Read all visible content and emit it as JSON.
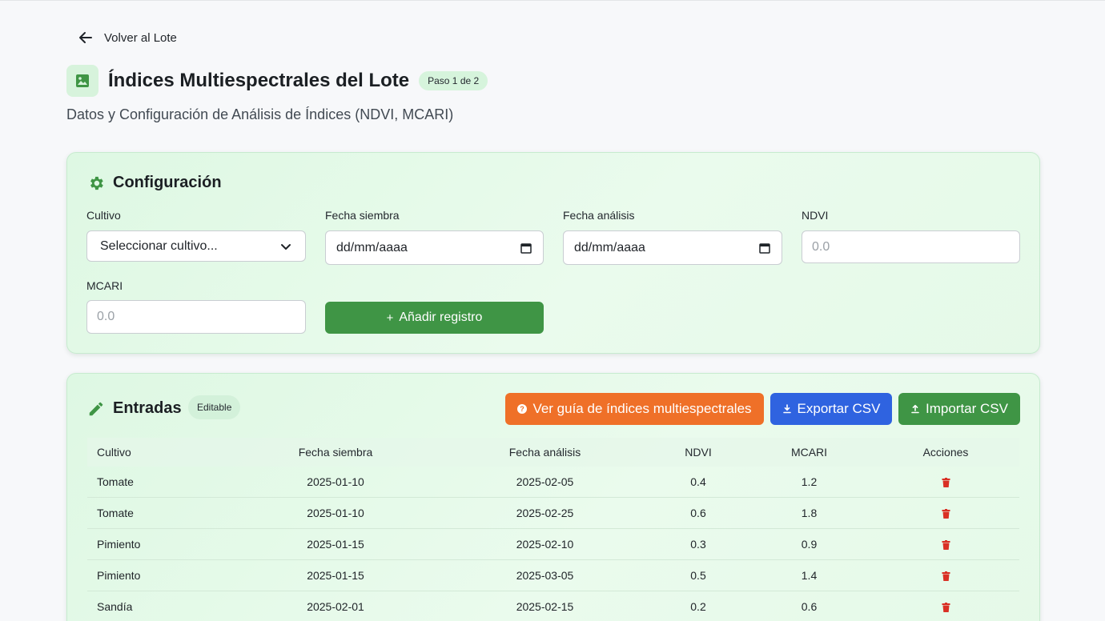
{
  "nav": {
    "back_label": "Volver al Lote"
  },
  "header": {
    "title": "Índices Multiespectrales del Lote",
    "step_badge": "Paso 1 de 2",
    "subtitle": "Datos y Configuración de Análisis de Índices (NDVI, MCARI)"
  },
  "config": {
    "title": "Configuración",
    "fields": {
      "cultivo": {
        "label": "Cultivo",
        "value": "Seleccionar cultivo..."
      },
      "fecha_siembra": {
        "label": "Fecha siembra",
        "value": "dd/mm/aaaa"
      },
      "fecha_analisis": {
        "label": "Fecha análisis",
        "value": "dd/mm/aaaa"
      },
      "ndvi": {
        "label": "NDVI",
        "placeholder": "0.0"
      },
      "mcari": {
        "label": "MCARI",
        "placeholder": "0.0"
      }
    },
    "add_button": "Añadir registro"
  },
  "entries": {
    "title": "Entradas",
    "badge": "Editable",
    "guide_button": "Ver guía de índices multiespectrales",
    "export_button": "Exportar CSV",
    "import_button": "Importar CSV",
    "columns": [
      "Cultivo",
      "Fecha siembra",
      "Fecha análisis",
      "NDVI",
      "MCARI",
      "Acciones"
    ],
    "rows": [
      [
        "Tomate",
        "2025-01-10",
        "2025-02-05",
        "0.4",
        "1.2"
      ],
      [
        "Tomate",
        "2025-01-10",
        "2025-02-25",
        "0.6",
        "1.8"
      ],
      [
        "Pimiento",
        "2025-01-15",
        "2025-02-10",
        "0.3",
        "0.9"
      ],
      [
        "Pimiento",
        "2025-01-15",
        "2025-03-05",
        "0.5",
        "1.4"
      ],
      [
        "Sandía",
        "2025-02-01",
        "2025-02-15",
        "0.2",
        "0.6"
      ]
    ]
  },
  "colors": {
    "accent_green": "#3f9545",
    "orange": "#ef7028",
    "blue": "#2f63e0",
    "danger": "#d93025"
  },
  "icons": {
    "back": "arrow-left-icon",
    "title": "image-icon",
    "config": "gear-icon",
    "entries": "pencil-icon",
    "guide": "question-circle-icon",
    "export": "download-icon",
    "import": "upload-icon",
    "delete": "trash-icon"
  }
}
